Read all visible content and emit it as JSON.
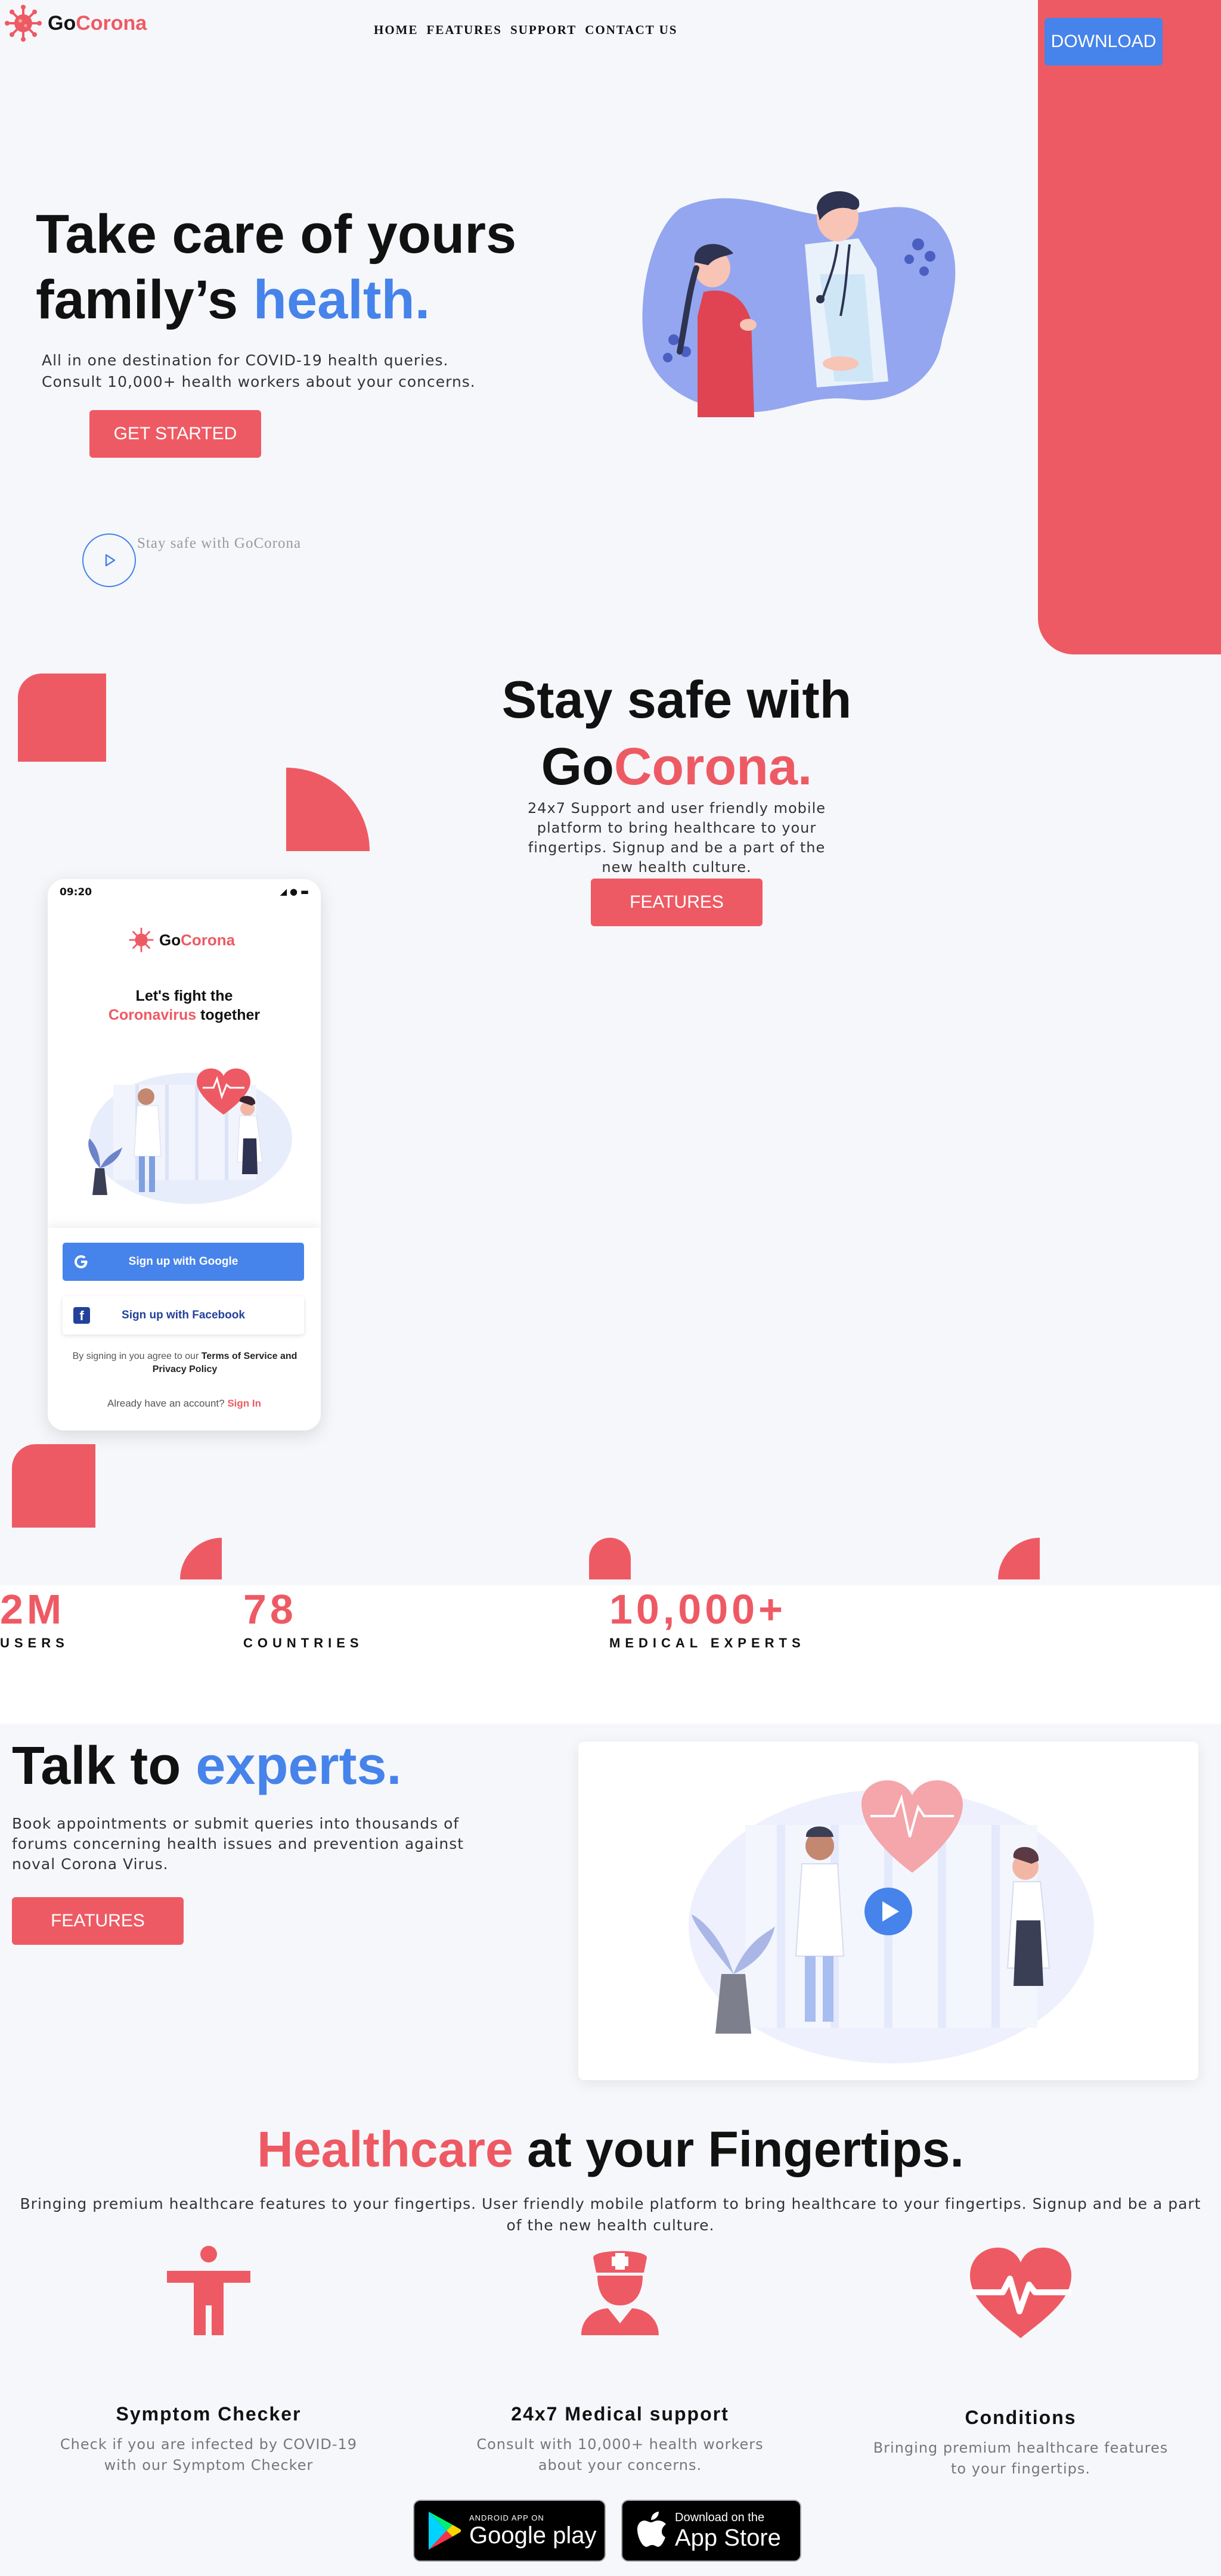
{
  "header": {
    "brand_go": "Go",
    "brand_corona": "Corona",
    "nav": [
      "HOME",
      "FEATURES",
      "SUPPORT",
      "CONTACT US"
    ],
    "download_label": "DOWNLOAD"
  },
  "hero": {
    "title_line1": "Take care of yours",
    "title_line2_prefix": "family’s ",
    "title_line2_highlight": "health.",
    "subtitle_line1": "All in one destination for COVID-19 health queries.",
    "subtitle_line2": "Consult 10,000+ health workers about your concerns.",
    "cta_label": "GET STARTED",
    "video_caption": "Stay safe with GoCorona"
  },
  "section2": {
    "title_line1": "Stay safe with",
    "title_go": "Go",
    "title_corona": "Corona.",
    "subtitle": "24x7 Support and user friendly mobile platform to bring healthcare to your fingertips. Signup and be a part of the new health culture.",
    "cta_label": "FEATURES"
  },
  "phone": {
    "time": "09:20",
    "brand_go": "Go",
    "brand_corona": "Corona",
    "heading_line1": "Let's fight the",
    "heading_red": "Coronavirus",
    "heading_rest": " together",
    "google_label": "Sign up with Google",
    "facebook_label": "Sign up with Facebook",
    "terms_prefix": "By signing in you agree to our ",
    "terms_link": "Terms of Service and Privacy Policy",
    "already_prefix": "Already have an account? ",
    "already_link": "Sign In"
  },
  "stats": [
    {
      "value": "2M",
      "label": "USERS"
    },
    {
      "value": "78",
      "label": "COUNTRIES"
    },
    {
      "value": "10,000+",
      "label": "MEDICAL EXPERTS"
    }
  ],
  "talk": {
    "title_prefix": "Talk to ",
    "title_highlight": "experts.",
    "subtitle": "Book appointments or submit queries into thousands of forums concerning health issues and prevention against noval Corona Virus.",
    "cta_label": "FEATURES"
  },
  "healthcare": {
    "title_red": "Healthcare",
    "title_rest": " at your Fingertips.",
    "subtitle": "Bringing premium healthcare features to your fingertips. User friendly mobile platform to bring healthcare to your fingertips. Signup and be a part of the new health culture.",
    "features": [
      {
        "title": "Symptom Checker",
        "text": "Check if you are infected by COVID-19 with our Symptom Checker",
        "icon": "person-icon"
      },
      {
        "title": "24x7 Medical support",
        "text": "Consult with 10,000+ health workers about your concerns.",
        "icon": "nurse-icon"
      },
      {
        "title": "Conditions",
        "text": "Bringing premium healthcare features to your fingertips.",
        "icon": "heartbeat-icon"
      }
    ]
  },
  "stores": {
    "google_small": "ANDROID APP ON",
    "google_big": "Google play",
    "apple_small": "Download on the",
    "apple_big": "App Store"
  },
  "colors": {
    "accent_red": "#ee5a64",
    "accent_blue": "#4683ea",
    "background": "#f6f7fb"
  }
}
